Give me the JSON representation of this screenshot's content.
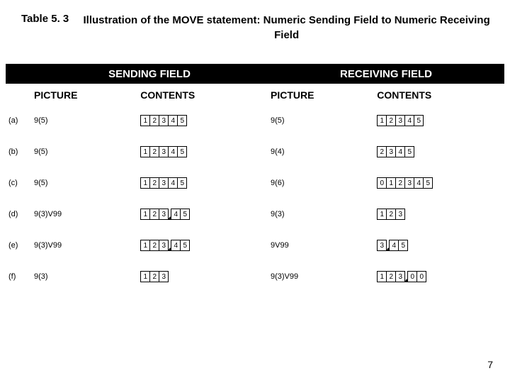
{
  "title_label": "Table 5. 3",
  "title_text": "Illustration of the MOVE statement:  Numeric Sending Field to Numeric Receiving Field",
  "header": {
    "sending": "SENDING FIELD",
    "receiving": "RECEIVING FIELD"
  },
  "subhead": {
    "picture": "PICTURE",
    "contents": "CONTENTS"
  },
  "rows": [
    {
      "label": "(a)",
      "send_pic": "9(5)",
      "send_cells": [
        "1",
        "2",
        "3",
        "4",
        "5"
      ],
      "recv_pic": "9(5)",
      "recv_cells": [
        "1",
        "2",
        "3",
        "4",
        "5"
      ]
    },
    {
      "label": "(b)",
      "send_pic": "9(5)",
      "send_cells": [
        "1",
        "2",
        "3",
        "4",
        "5"
      ],
      "recv_pic": "9(4)",
      "recv_cells": [
        "2",
        "3",
        "4",
        "5"
      ]
    },
    {
      "label": "(c)",
      "send_pic": "9(5)",
      "send_cells": [
        "1",
        "2",
        "3",
        "4",
        "5"
      ],
      "recv_pic": "9(6)",
      "recv_cells": [
        "0",
        "1",
        "2",
        "3",
        "4",
        "5"
      ]
    },
    {
      "label": "(d)",
      "send_pic": "9(3)V99",
      "send_cells": [
        "1",
        "2",
        "3",
        "^",
        "4",
        "5"
      ],
      "recv_pic": "9(3)",
      "recv_cells": [
        "1",
        "2",
        "3"
      ]
    },
    {
      "label": "(e)",
      "send_pic": "9(3)V99",
      "send_cells": [
        "1",
        "2",
        "3",
        "^",
        "4",
        "5"
      ],
      "recv_pic": "9V99",
      "recv_cells": [
        "3",
        "^",
        "4",
        "5"
      ]
    },
    {
      "label": "(f)",
      "send_pic": "9(3)",
      "send_cells": [
        "1",
        "2",
        "3"
      ],
      "recv_pic": "9(3)V99",
      "recv_cells": [
        "1",
        "2",
        "3",
        "^",
        "0",
        "0"
      ]
    }
  ],
  "page_number": "7"
}
